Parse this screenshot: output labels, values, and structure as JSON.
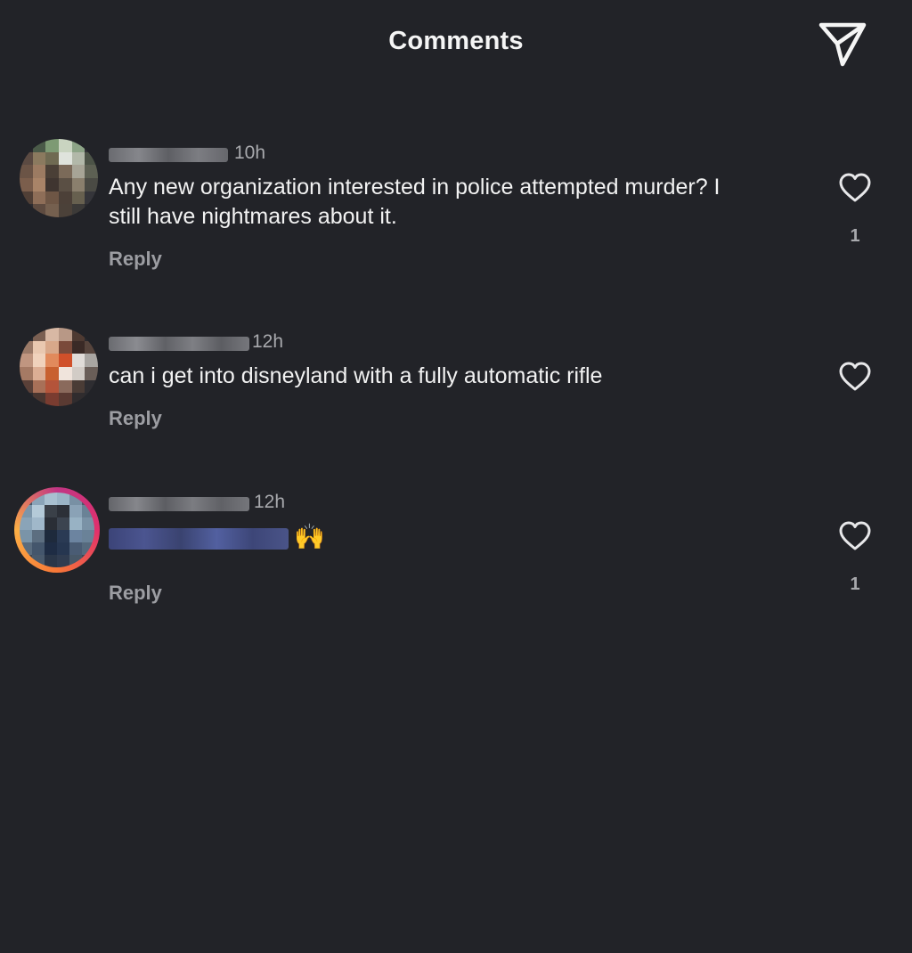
{
  "header": {
    "title": "Comments",
    "share_icon": "send-paper-plane-icon"
  },
  "colors": {
    "background": "#222328",
    "text": "#f2f2f2",
    "muted": "#a8a9ad",
    "reply": "#9c9da2"
  },
  "comments": [
    {
      "time": "10h",
      "text": "Any new organization interested in police attempted murder? I still have nightmares about it.",
      "reply_label": "Reply",
      "like_count": "1",
      "username_obscured": true
    },
    {
      "time": "12h",
      "text": "can i get into disneyland with a fully automatic rifle",
      "reply_label": "Reply",
      "like_count": "",
      "username_obscured": true
    },
    {
      "time": "12h",
      "emoji": "🙌",
      "reply_label": "Reply",
      "like_count": "1",
      "username_obscured": true,
      "text_obscured": true
    }
  ]
}
